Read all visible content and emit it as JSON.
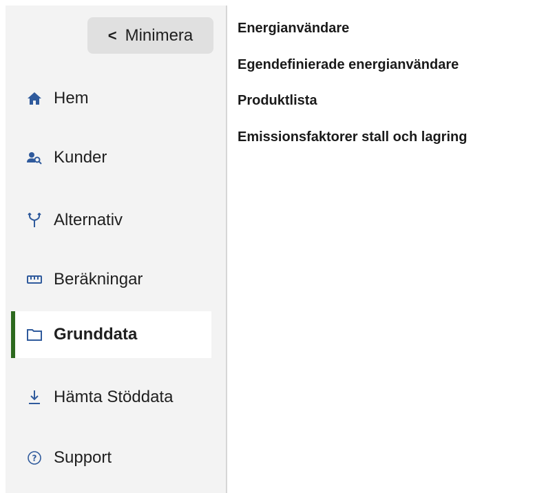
{
  "sidebar": {
    "minimize_label": "Minimera",
    "items": [
      {
        "label": "Hem",
        "icon": "home-icon"
      },
      {
        "label": "Kunder",
        "icon": "customers-icon"
      },
      {
        "label": "Alternativ",
        "icon": "merge-icon"
      },
      {
        "label": "Beräkningar",
        "icon": "ruler-icon"
      },
      {
        "label": "Grunddata",
        "icon": "folder-icon",
        "active": true
      },
      {
        "label": "Hämta Stöddata",
        "icon": "download-icon"
      },
      {
        "label": "Support",
        "icon": "help-icon"
      }
    ]
  },
  "main": {
    "links": [
      "Energianvändare",
      "Egendefinierade energianvändare",
      "Produktlista",
      "Emissionsfaktorer stall och lagring"
    ]
  },
  "colors": {
    "accent": "#2d6a1f",
    "icon": "#2f5a9c",
    "sidebar_bg": "#f3f3f3",
    "button_bg": "#e0e0e0"
  }
}
